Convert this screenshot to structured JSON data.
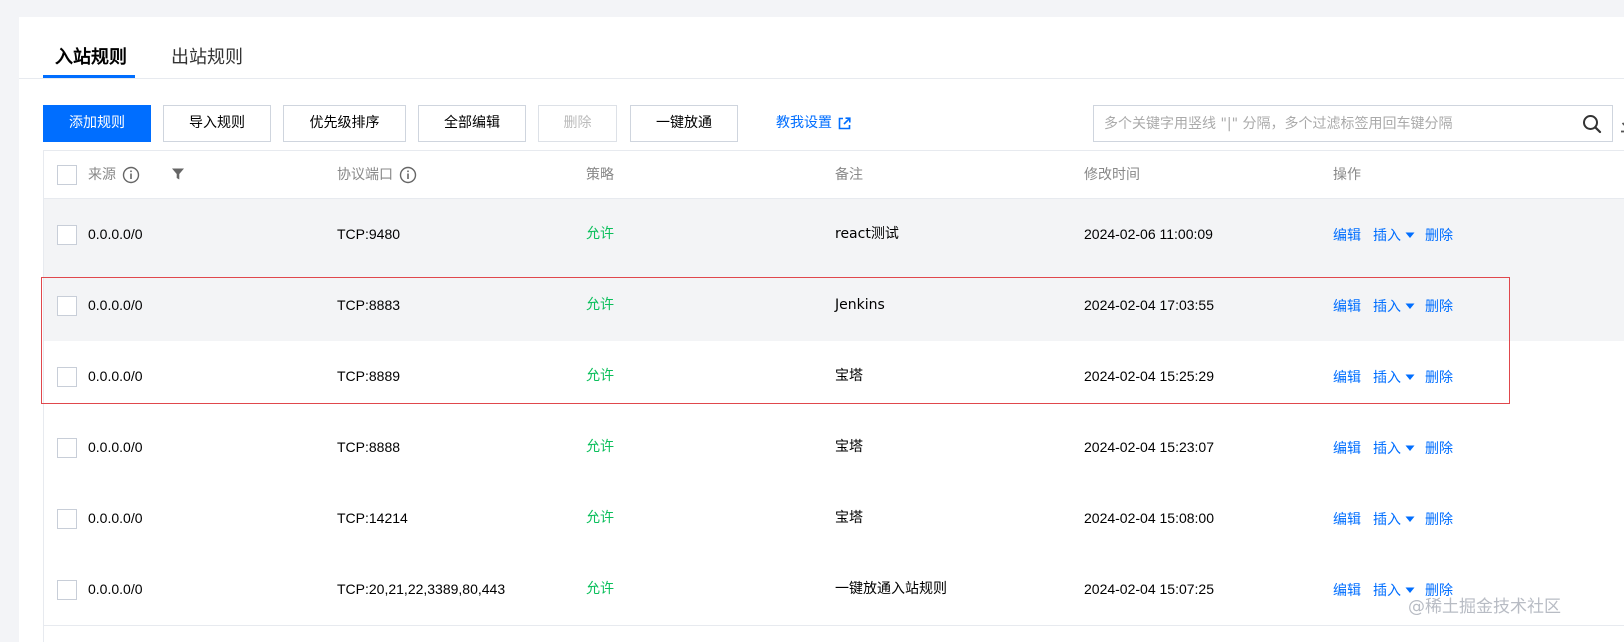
{
  "tabs": [
    {
      "label": "入站规则",
      "active": true
    },
    {
      "label": "出站规则",
      "active": false
    }
  ],
  "toolbar": {
    "add_label": "添加规则",
    "import_label": "导入规则",
    "priority_label": "优先级排序",
    "edit_all_label": "全部编辑",
    "delete_label": "删除",
    "allow_all_label": "一键放通",
    "help_label": "教我设置",
    "search_placeholder": "多个关键字用竖线 \"|\" 分隔，多个过滤标签用回车键分隔"
  },
  "table": {
    "headers": {
      "source": "来源",
      "port": "协议端口",
      "policy": "策略",
      "note": "备注",
      "modified": "修改时间",
      "actions": "操作"
    },
    "action_labels": {
      "edit": "编辑",
      "insert": "插入",
      "delete": "删除"
    },
    "rows": [
      {
        "source": "0.0.0.0/0",
        "port": "TCP:9480",
        "policy": "允许",
        "note": "react测试",
        "modified": "2024-02-06 11:00:09"
      },
      {
        "source": "0.0.0.0/0",
        "port": "TCP:8883",
        "policy": "允许",
        "note": "Jenkins",
        "modified": "2024-02-04 17:03:55"
      },
      {
        "source": "0.0.0.0/0",
        "port": "TCP:8889",
        "policy": "允许",
        "note": "宝塔",
        "modified": "2024-02-04 15:25:29"
      },
      {
        "source": "0.0.0.0/0",
        "port": "TCP:8888",
        "policy": "允许",
        "note": "宝塔",
        "modified": "2024-02-04 15:23:07"
      },
      {
        "source": "0.0.0.0/0",
        "port": "TCP:14214",
        "policy": "允许",
        "note": "宝塔",
        "modified": "2024-02-04 15:08:00"
      },
      {
        "source": "0.0.0.0/0",
        "port": "TCP:20,21,22,3389,80,443",
        "policy": "允许",
        "note": "一键放通入站规则",
        "modified": "2024-02-04 15:07:25"
      }
    ]
  },
  "watermark": "@稀土掘金技术社区",
  "colors": {
    "primary": "#006eff",
    "allow": "#0abf5b",
    "highlight": "#e0474c"
  }
}
